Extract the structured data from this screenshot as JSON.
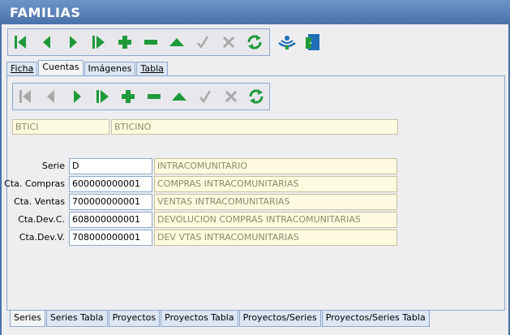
{
  "window": {
    "title": "FAMILIAS"
  },
  "tabs_top": [
    {
      "label": "Ficha",
      "active": false
    },
    {
      "label": "Cuentas",
      "active": true
    },
    {
      "label": "Imágenes",
      "active": false
    },
    {
      "label": "Tabla",
      "active": false
    }
  ],
  "record": {
    "code": "BTICI",
    "name": "BTICINO"
  },
  "fields": [
    {
      "label": "Serie",
      "value": "D",
      "description": "INTRACOMUNITARIO"
    },
    {
      "label": "Cta. Compras",
      "value": "600000000001",
      "description": "COMPRAS INTRACOMUNITARIAS"
    },
    {
      "label": "Cta. Ventas",
      "value": "700000000001",
      "description": "VENTAS INTRACOMUNITARIAS"
    },
    {
      "label": "Cta.Dev.C.",
      "value": "608000000001",
      "description": "DEVOLUCION COMPRAS INTRACOMUNITARIAS"
    },
    {
      "label": "Cta.Dev.V.",
      "value": "708000000001",
      "description": "DEV VTAS INTRACOMUNITARIAS"
    }
  ],
  "tabs_bottom": [
    {
      "label": "Series",
      "active": true
    },
    {
      "label": "Series Tabla",
      "active": false
    },
    {
      "label": "Proyectos",
      "active": false
    },
    {
      "label": "Proyectos Tabla",
      "active": false
    },
    {
      "label": "Proyectos/Series",
      "active": false
    },
    {
      "label": "Proyectos/Series Tabla",
      "active": false
    }
  ],
  "colors": {
    "title_bar": "#4a72ab",
    "icon_green": "#1e9a3a",
    "icon_disabled": "#a8a8a8",
    "readonly_field": "#fffbe0"
  },
  "icons": [
    "first-record-icon",
    "prev-record-icon",
    "next-record-icon",
    "last-record-icon",
    "add-icon",
    "delete-icon",
    "edit-icon",
    "confirm-icon",
    "cancel-icon",
    "refresh-icon",
    "contacts-icon",
    "exit-door-icon"
  ]
}
